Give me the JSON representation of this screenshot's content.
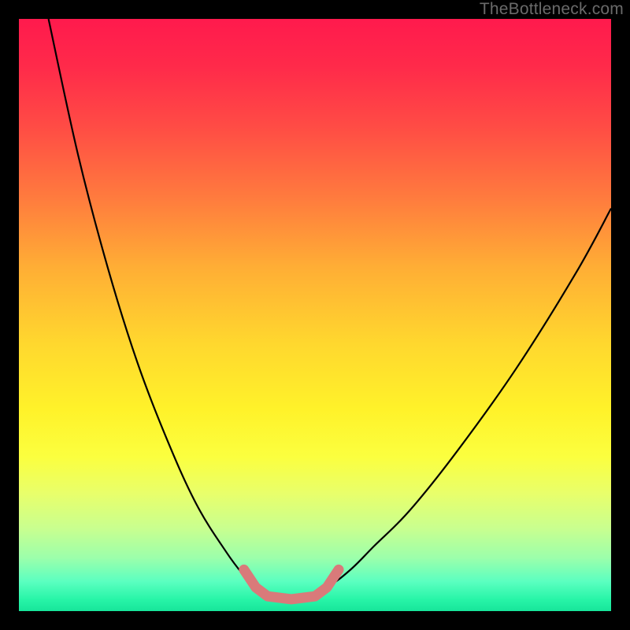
{
  "watermark": "TheBottleneck.com",
  "colors": {
    "gradient_top": "#ff1a4d",
    "gradient_bottom": "#17e59a",
    "curve": "#000000",
    "marker": "#d97a7a",
    "frame_bg": "#000000"
  },
  "chart_data": {
    "type": "line",
    "title": "",
    "xlabel": "",
    "ylabel": "",
    "xlim": [
      0,
      100
    ],
    "ylim": [
      0,
      100
    ],
    "series": [
      {
        "name": "left-branch",
        "x": [
          5,
          10,
          15,
          20,
          25,
          30,
          35,
          38,
          40,
          42,
          44
        ],
        "y": [
          100,
          77,
          58,
          42,
          29,
          18,
          10,
          6,
          4,
          2.5,
          2
        ]
      },
      {
        "name": "right-branch",
        "x": [
          44,
          46,
          48,
          52,
          56,
          60,
          66,
          74,
          84,
          94,
          100
        ],
        "y": [
          2,
          2,
          2.5,
          4,
          7,
          11,
          17,
          27,
          41,
          57,
          68
        ]
      }
    ],
    "highlight_region": {
      "name": "bottom-trough-marker",
      "points": [
        {
          "x": 38,
          "y": 7
        },
        {
          "x": 40,
          "y": 4
        },
        {
          "x": 42,
          "y": 2.5
        },
        {
          "x": 46,
          "y": 2
        },
        {
          "x": 50,
          "y": 2.5
        },
        {
          "x": 52,
          "y": 4
        },
        {
          "x": 54,
          "y": 7
        }
      ]
    }
  }
}
